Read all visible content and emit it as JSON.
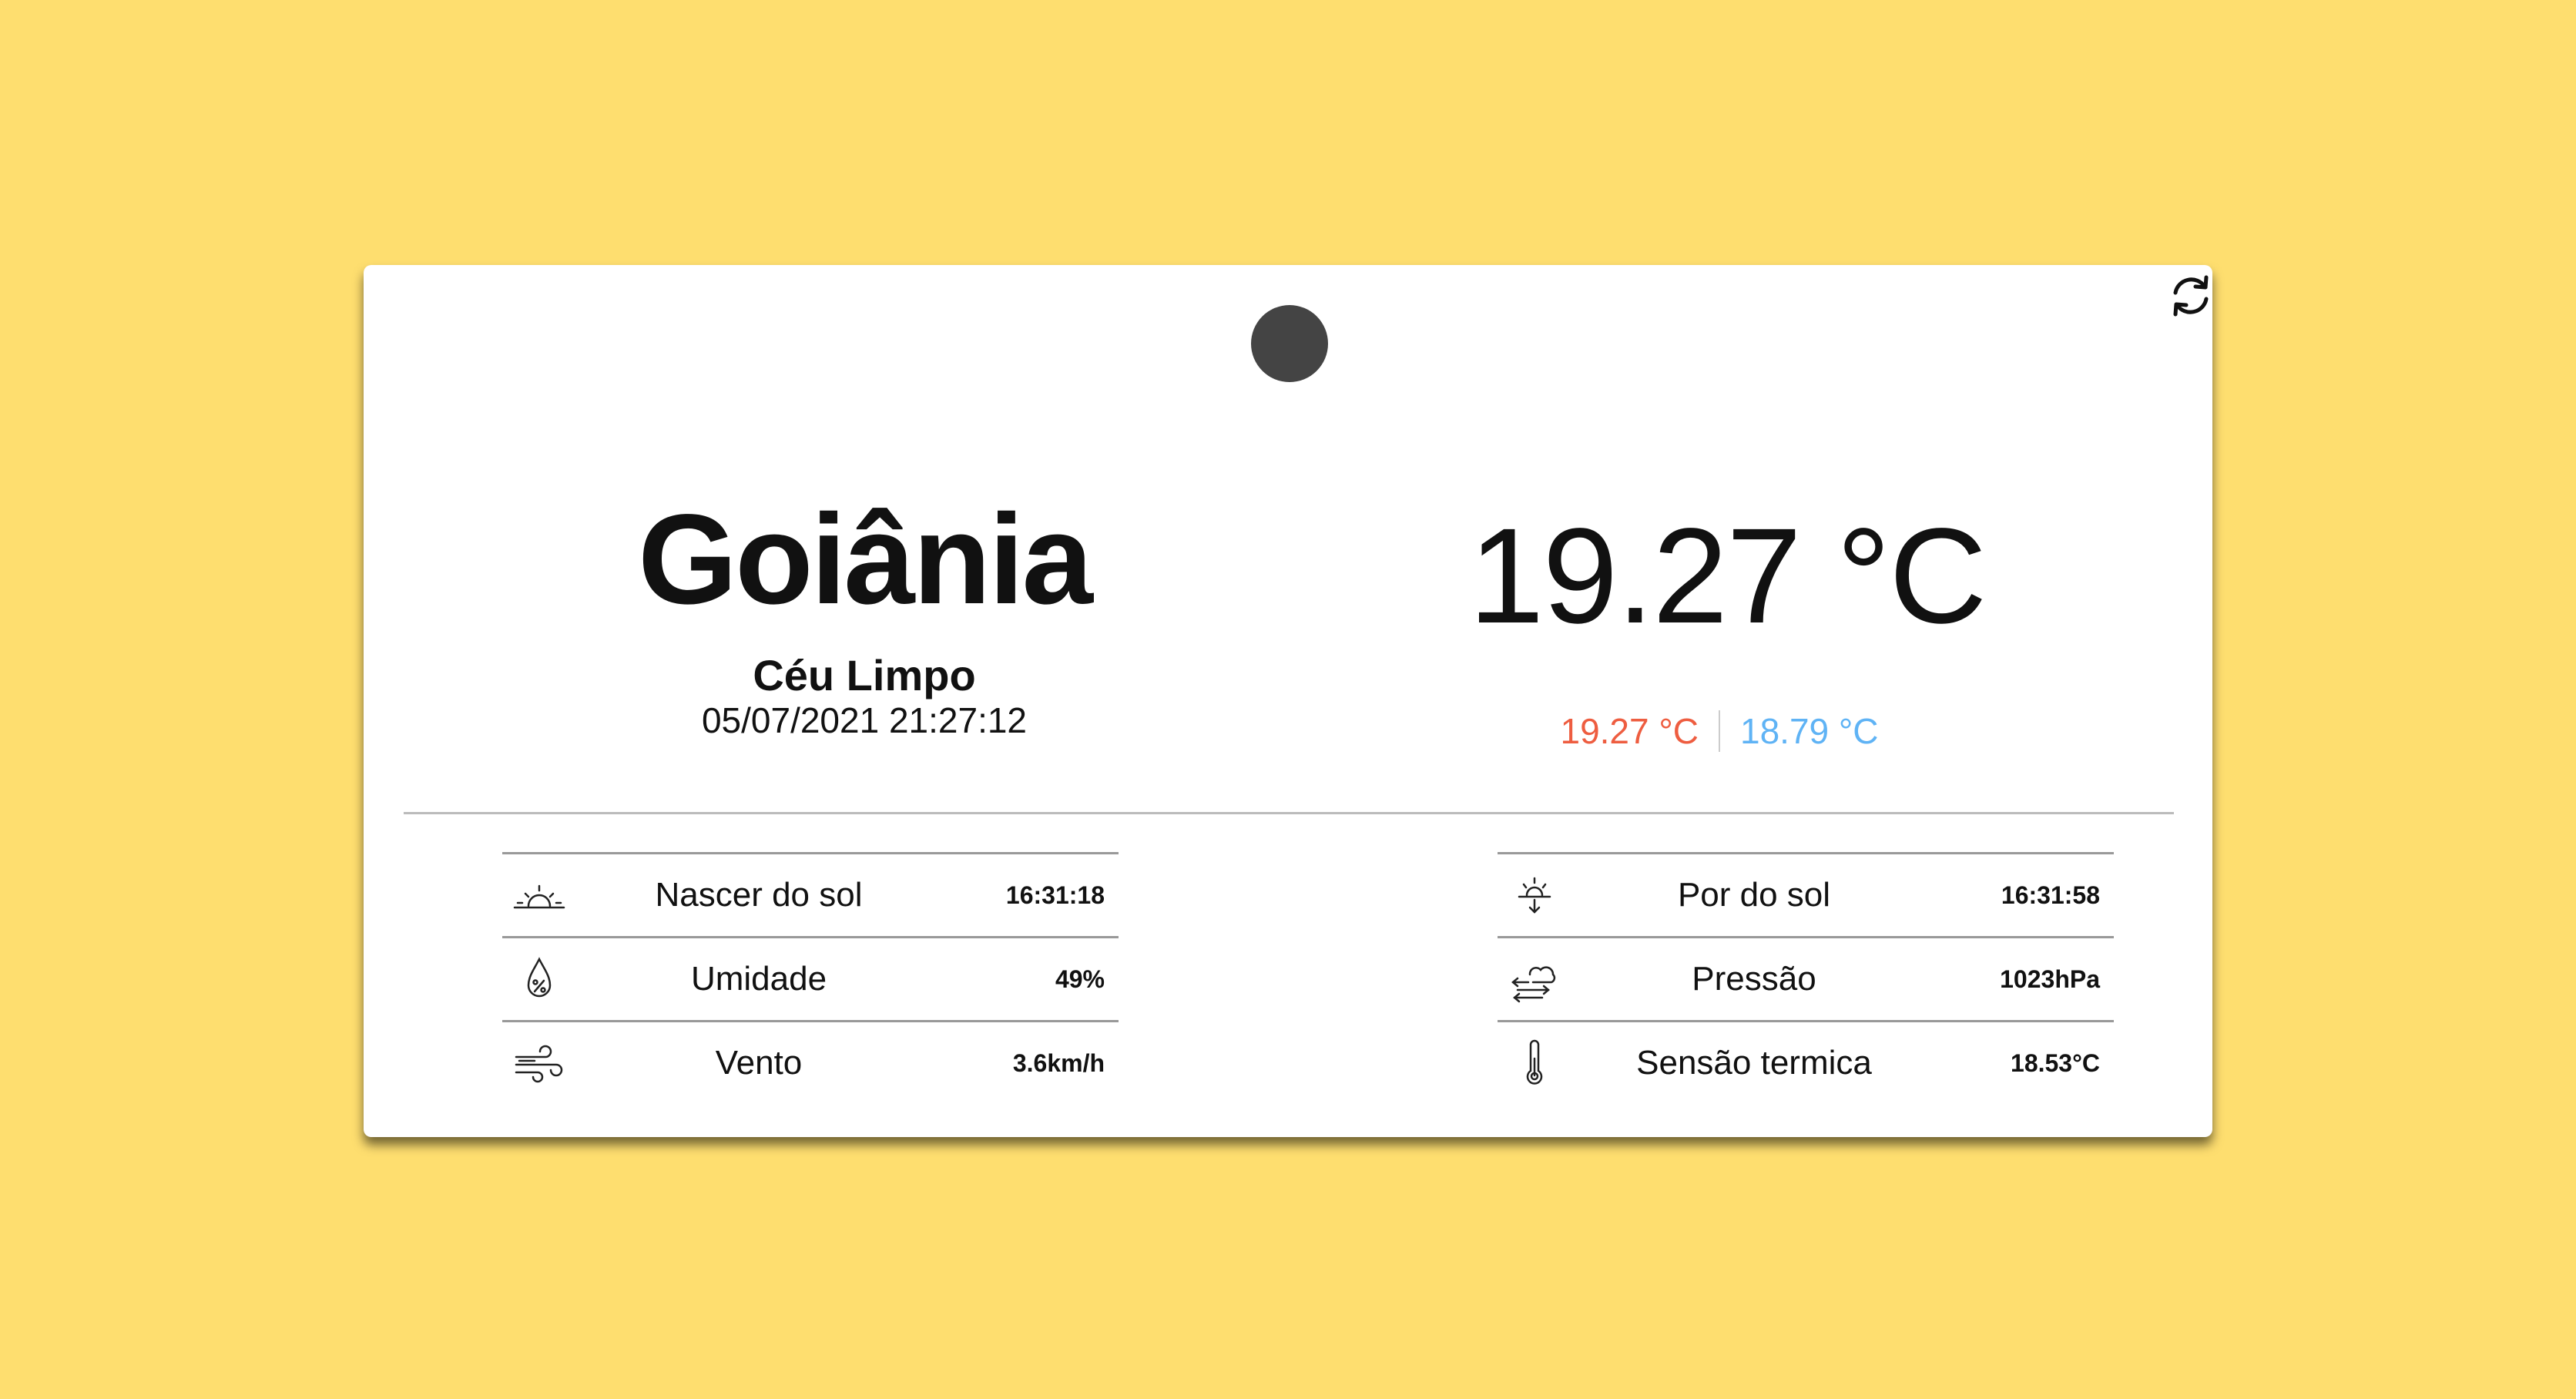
{
  "weather": {
    "city": "Goiânia",
    "description": "Céu Limpo",
    "datetime": "05/07/2021 21:27:12",
    "temperature": "19.27 °C",
    "temp_max": "19.27 °C",
    "temp_min": "18.79 °C"
  },
  "stats_left": [
    {
      "icon": "sunrise-icon",
      "label": "Nascer do sol",
      "value": "16:31:18"
    },
    {
      "icon": "humidity-icon",
      "label": "Umidade",
      "value": "49%"
    },
    {
      "icon": "wind-icon",
      "label": "Vento",
      "value": "3.6km/h"
    }
  ],
  "stats_right": [
    {
      "icon": "sunset-icon",
      "label": "Por do sol",
      "value": "16:31:58"
    },
    {
      "icon": "pressure-icon",
      "label": "Pressão",
      "value": "1023hPa"
    },
    {
      "icon": "thermometer-icon",
      "label": "Sensão termica",
      "value": "18.53°C"
    }
  ],
  "colors": {
    "background": "#FEDE6F",
    "max_temp": "#EE5D40",
    "min_temp": "#5FB3F5",
    "weather_dot": "#444444"
  }
}
